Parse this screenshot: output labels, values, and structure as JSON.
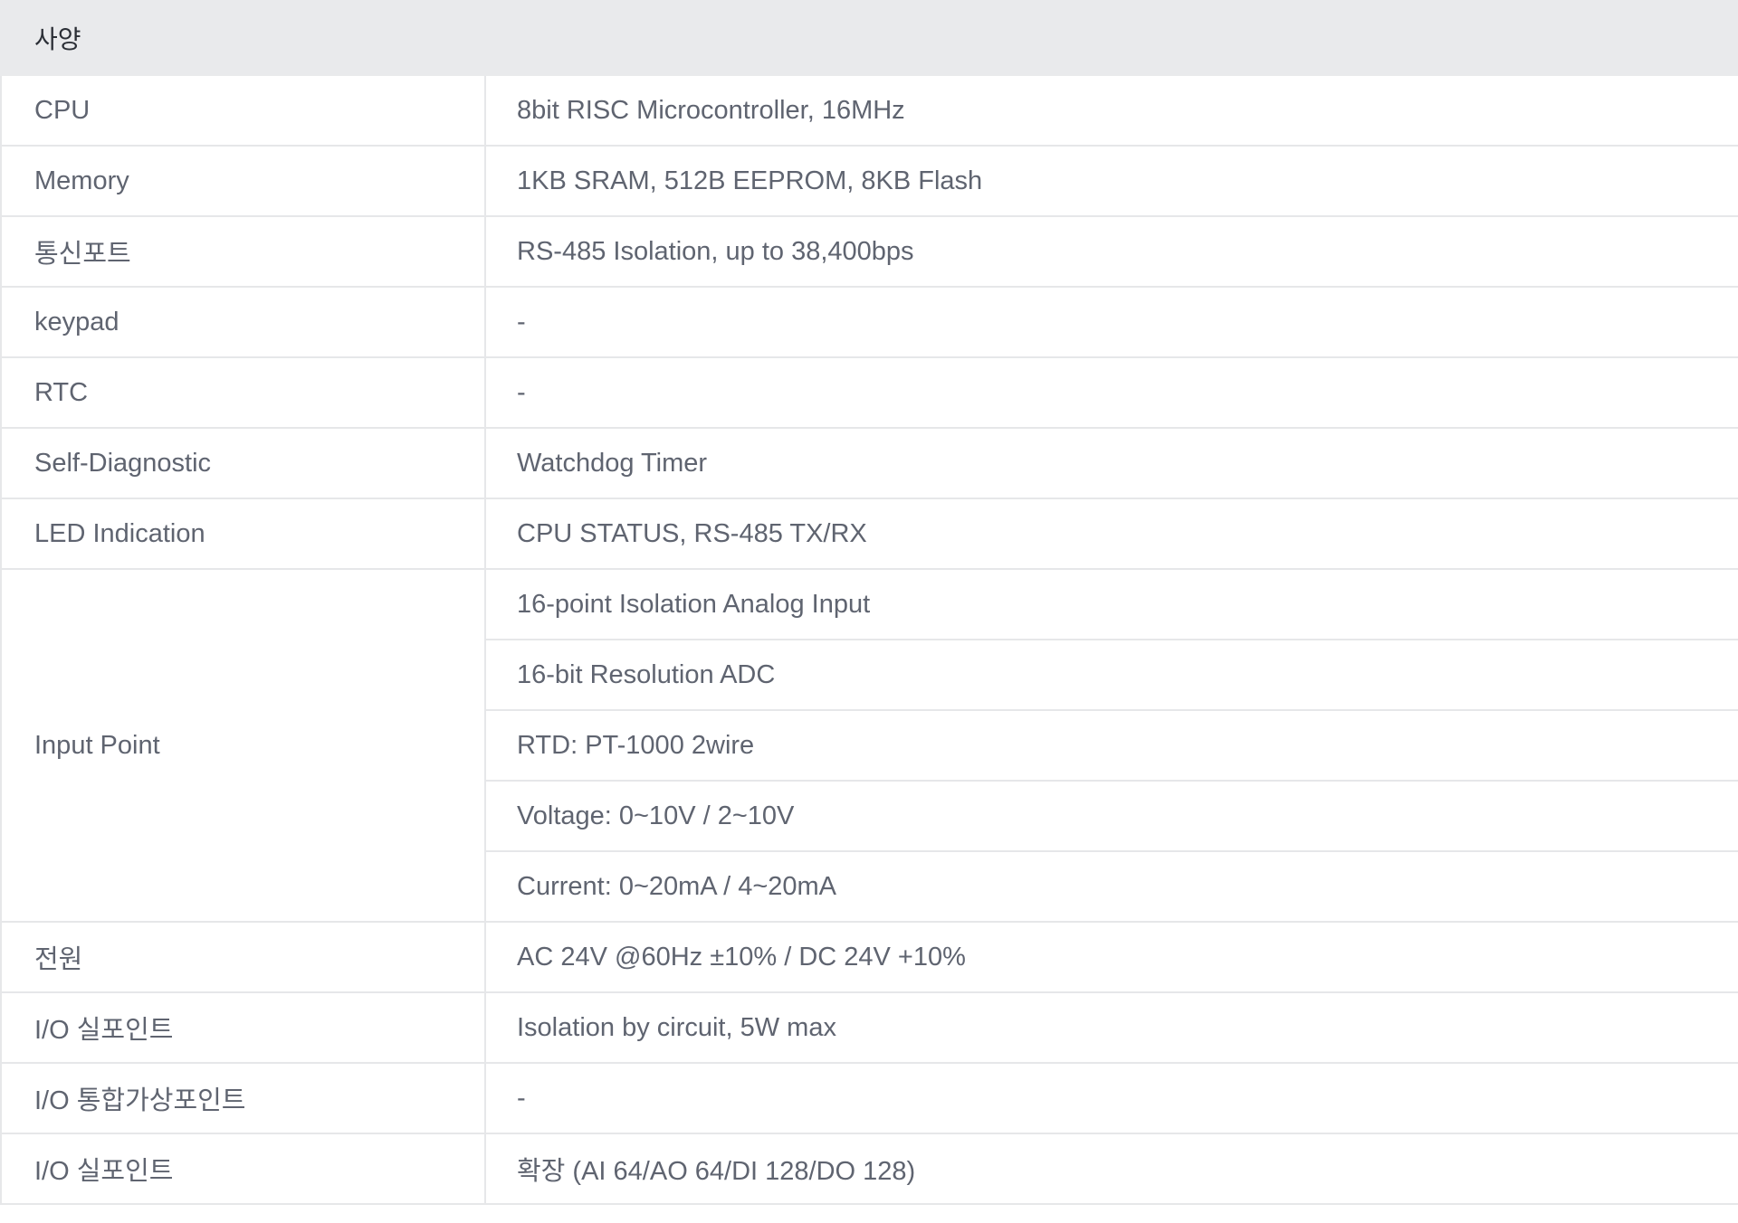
{
  "table": {
    "header": "사양",
    "rows": [
      {
        "label": "CPU",
        "value": "8bit RISC Microcontroller, 16MHz"
      },
      {
        "label": "Memory",
        "value": "1KB SRAM, 512B EEPROM, 8KB Flash"
      },
      {
        "label": "통신포트",
        "value": "RS-485 Isolation, up to 38,400bps"
      },
      {
        "label": "keypad",
        "value": "-"
      },
      {
        "label": "RTC",
        "value": "-"
      },
      {
        "label": "Self-Diagnostic",
        "value": "Watchdog Timer"
      },
      {
        "label": "LED Indication",
        "value": "CPU STATUS, RS-485 TX/RX"
      }
    ],
    "input_point": {
      "label": "Input Point",
      "values": [
        "16-point Isolation Analog Input",
        "16-bit Resolution ADC",
        "RTD: PT-1000 2wire",
        "Voltage: 0~10V / 2~10V",
        "Current: 0~20mA / 4~20mA"
      ]
    },
    "rows_after": [
      {
        "label": "전원",
        "value": "AC 24V @60Hz ±10% / DC 24V +10%"
      },
      {
        "label": "I/O 실포인트",
        "value": "Isolation by circuit, 5W max"
      },
      {
        "label": "I/O 통합가상포인트",
        "value": "-"
      },
      {
        "label": "I/O 실포인트",
        "value": "확장 (AI 64/AO 64/DI 128/DO 128)"
      }
    ]
  }
}
